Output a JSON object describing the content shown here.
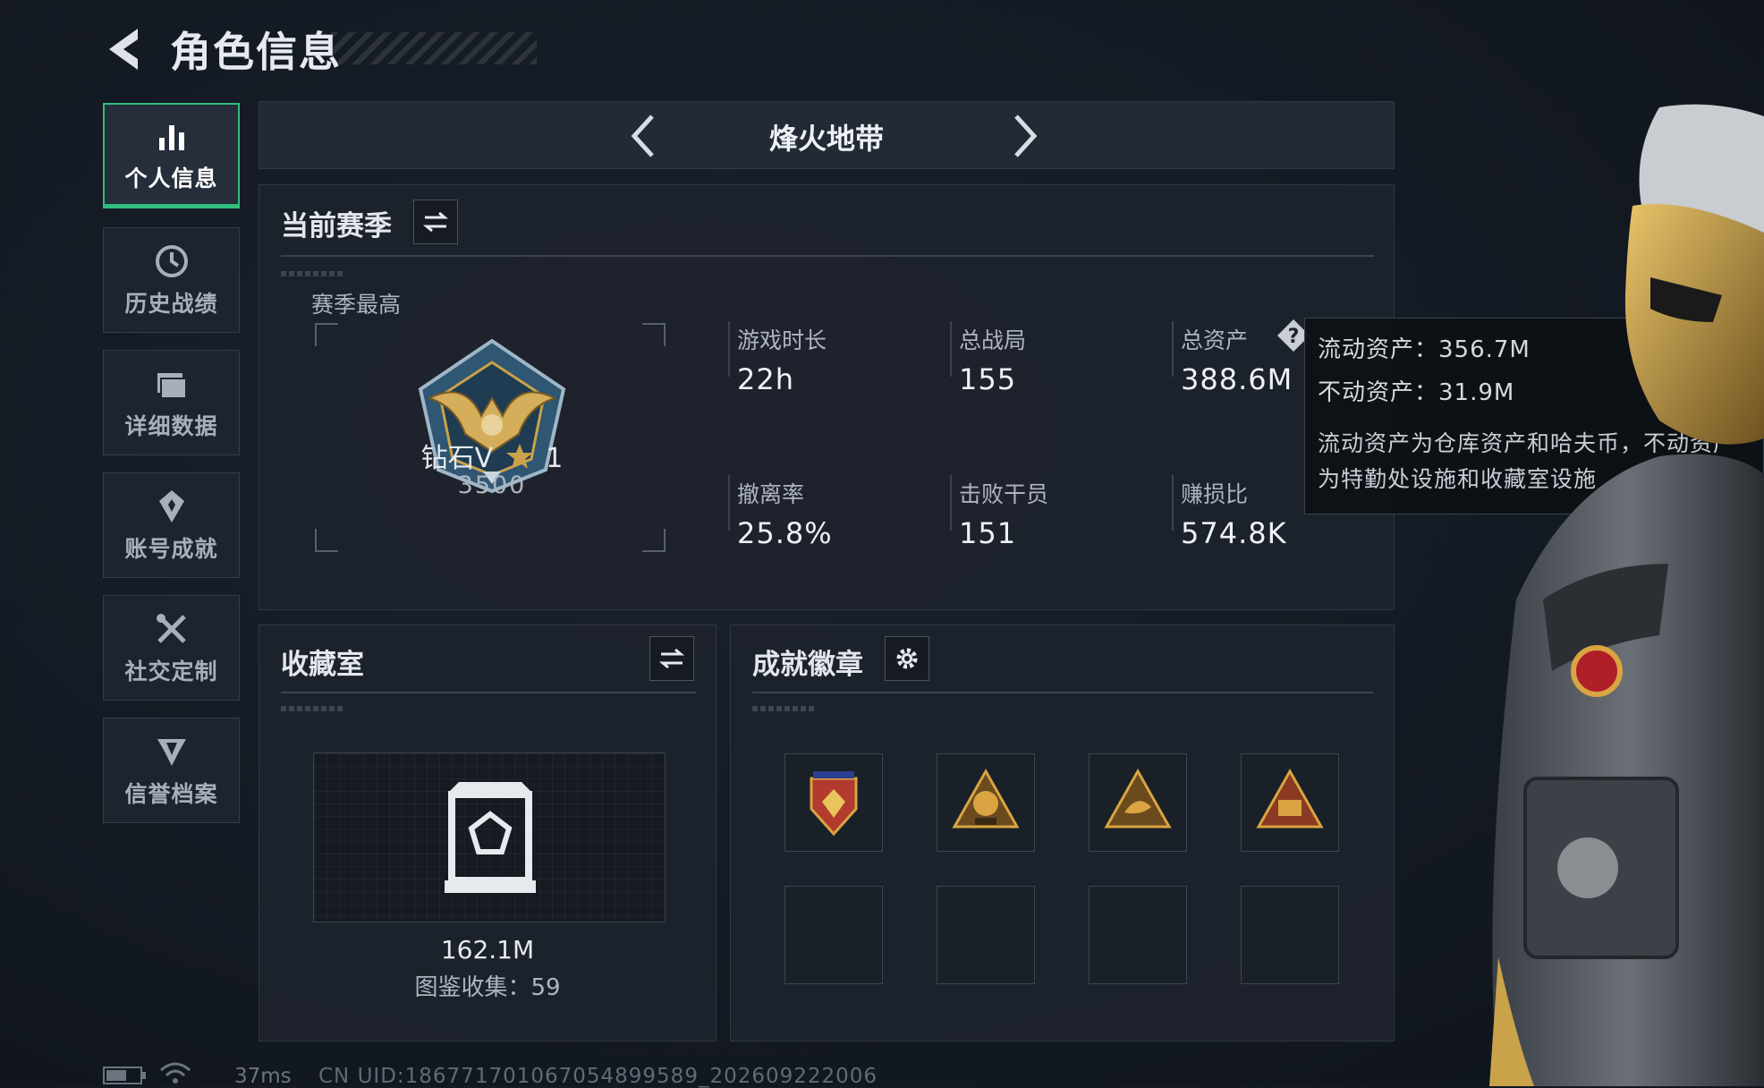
{
  "header": {
    "title": "角色信息"
  },
  "sidebar": {
    "items": [
      {
        "label": "个人信息",
        "icon": "bar-chart-icon",
        "active": true
      },
      {
        "label": "历史战绩",
        "icon": "clock-icon"
      },
      {
        "label": "详细数据",
        "icon": "folder-icon"
      },
      {
        "label": "账号成就",
        "icon": "badge-icon"
      },
      {
        "label": "社交定制",
        "icon": "tools-icon"
      },
      {
        "label": "信誉档案",
        "icon": "shield-icon"
      }
    ]
  },
  "mode": {
    "title": "烽火地带"
  },
  "season": {
    "title": "当前赛季",
    "best_label": "赛季最高",
    "rank": "钻石V",
    "stars": "1",
    "score": "3500",
    "stats": [
      {
        "label": "游戏时长",
        "value": "22h"
      },
      {
        "label": "总战局",
        "value": "155"
      },
      {
        "label": "总资产",
        "value": "388.6M"
      },
      {
        "label": "撤离率",
        "value": "25.8%"
      },
      {
        "label": "击败干员",
        "value": "151"
      },
      {
        "label": "赚损比",
        "value": "574.8K"
      }
    ]
  },
  "tooltip": {
    "liquid": "流动资产：356.7M",
    "fixed": "不动资产：31.9M",
    "desc": "流动资产为仓库资产和哈夫币，不动资产为特勤处设施和收藏室设施"
  },
  "collection": {
    "title": "收藏室",
    "value": "162.1M",
    "count_text": "图鉴收集：59"
  },
  "achievements": {
    "title": "成就徽章",
    "badges": [
      "badge-eagle-icon",
      "badge-518-icon",
      "badge-fish-icon",
      "badge-s11-icon"
    ]
  },
  "footer": {
    "ping": "37ms",
    "uid": "CN UID:1867717010670548995​89_202609222006"
  },
  "colors": {
    "accent": "#2fbf7c",
    "gold": "#c9a24a",
    "background": "#141a23"
  }
}
